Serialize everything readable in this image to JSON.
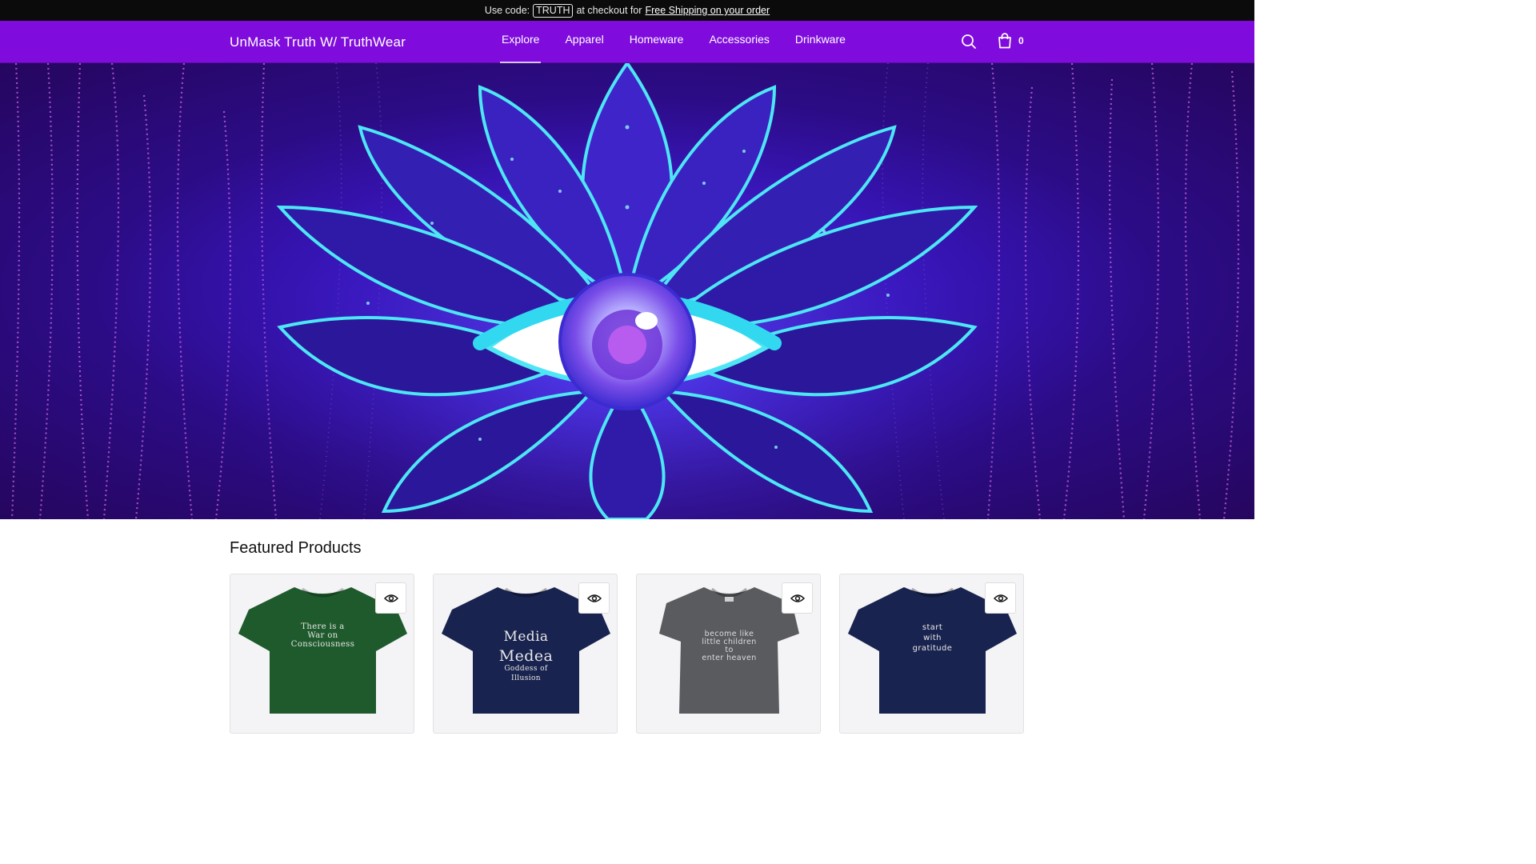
{
  "promo": {
    "prefix": "Use code:",
    "code": "TRUTH",
    "middle": "at checkout for",
    "link": "Free Shipping on your order"
  },
  "header": {
    "logo": "UnMask Truth W/ TruthWear",
    "nav": [
      "Explore",
      "Apparel",
      "Homeware",
      "Accessories",
      "Drinkware"
    ],
    "active_nav": "Explore",
    "cart_count": "0",
    "icons": [
      "search-icon",
      "shopping-bag-icon"
    ]
  },
  "hero": {
    "image": "third-eye-lotus-illustration"
  },
  "featured": {
    "title": "Featured Products",
    "products": [
      {
        "color": "#1f5a2c",
        "lines": [
          "There is a",
          "War on",
          "Consciousness"
        ],
        "quick_view_icon": "eye-icon"
      },
      {
        "color": "#18234f",
        "lines": [
          "Media",
          "Medea",
          "Goddess of",
          "Illusion"
        ],
        "quick_view_icon": "eye-icon"
      },
      {
        "color": "#5a5b5f",
        "lines": [
          "become like",
          "little children",
          "to",
          "enter heaven"
        ],
        "quick_view_icon": "eye-icon"
      },
      {
        "color": "#18234f",
        "lines": [
          "start",
          "with",
          "gratitude"
        ],
        "quick_view_icon": "eye-icon"
      }
    ]
  },
  "colors": {
    "promo_bg": "#0b0b0b",
    "header_bg": "#7f0cdc",
    "hero_bg": "#2c0c86",
    "accent_cyan": "#4ee6f5"
  }
}
